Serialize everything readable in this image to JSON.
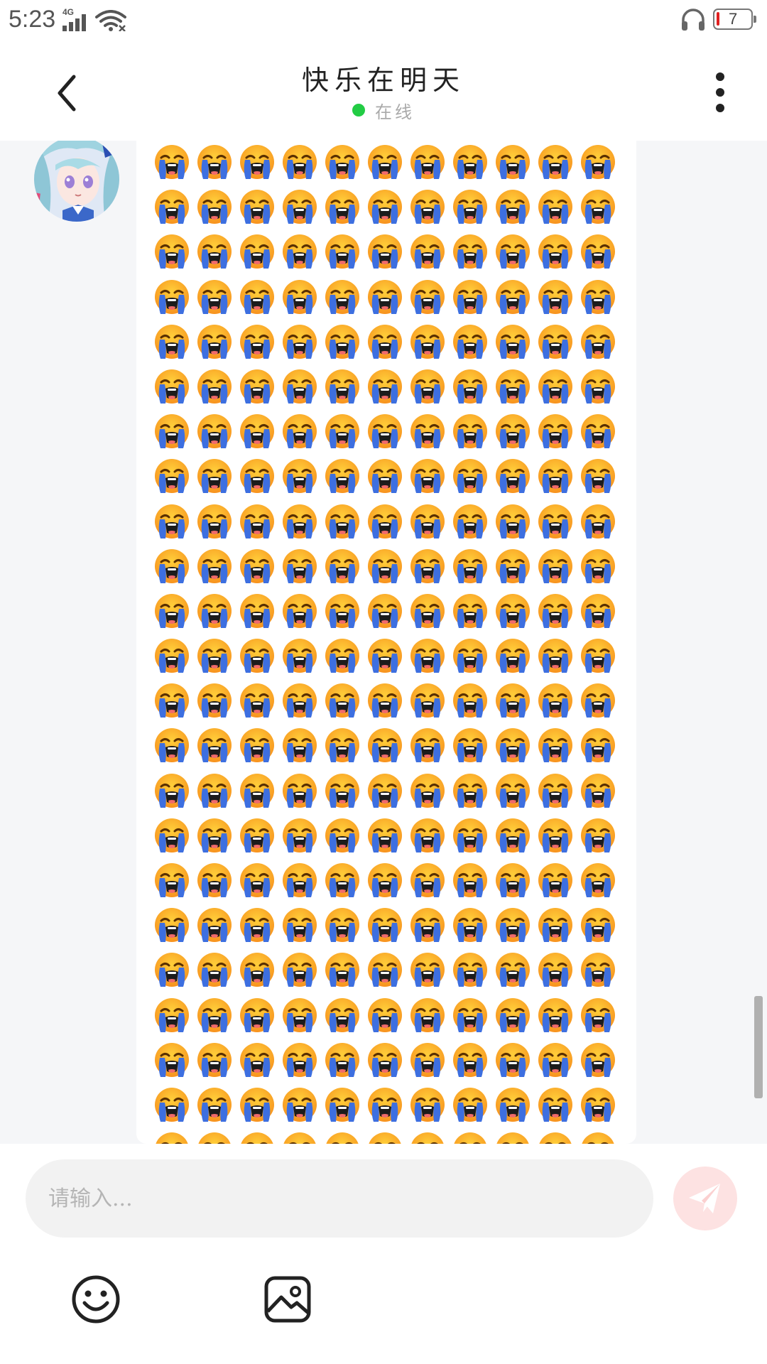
{
  "status_bar": {
    "time": "5:23",
    "network": "4G",
    "battery": "7",
    "icons": [
      "signal-icon",
      "wifi-icon",
      "headset-icon",
      "battery-icon"
    ]
  },
  "header": {
    "title": "快乐在明天",
    "status": "在线",
    "status_color": "#22cc44",
    "icons": [
      "back-arrow-icon",
      "more-vertical-icon"
    ]
  },
  "chat": {
    "messages": [
      {
        "sender": "contact",
        "avatar": "anime-avatar",
        "content_icon": "loudly-crying-face-emoji"
      }
    ]
  },
  "composer": {
    "placeholder": "请输入...",
    "value": "",
    "send_icon": "paper-plane-icon",
    "send_color": "#fde2e2",
    "toolbar_icons": [
      "smiley-icon",
      "image-icon"
    ]
  }
}
